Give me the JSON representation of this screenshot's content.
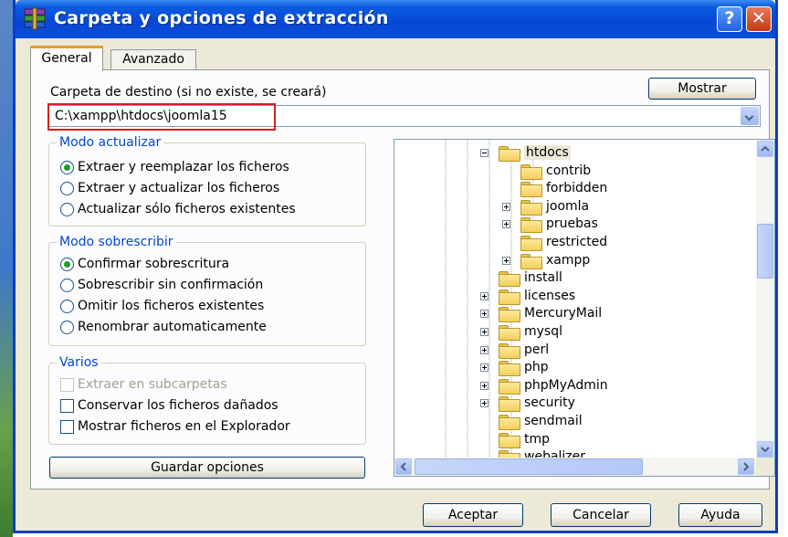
{
  "window": {
    "title": "Carpeta y opciones de extracción",
    "help_label": "?",
    "close_label": "✕"
  },
  "tabs": [
    {
      "label": "General",
      "active": true
    },
    {
      "label": "Avanzado",
      "active": false
    }
  ],
  "destination": {
    "label": "Carpeta de destino (si no existe, se creará)",
    "show_button": "Mostrar",
    "path": "C:\\xampp\\htdocs\\joomla15"
  },
  "update_mode": {
    "title": "Modo actualizar",
    "options": [
      {
        "label": "Extraer y reemplazar los ficheros",
        "selected": true
      },
      {
        "label": "Extraer y actualizar los ficheros",
        "selected": false
      },
      {
        "label": "Actualizar sólo ficheros existentes",
        "selected": false
      }
    ]
  },
  "overwrite_mode": {
    "title": "Modo sobrescribir",
    "options": [
      {
        "label": "Confirmar sobrescritura",
        "selected": true
      },
      {
        "label": "Sobrescribir sin confirmación",
        "selected": false
      },
      {
        "label": "Omitir los ficheros existentes",
        "selected": false
      },
      {
        "label": "Renombrar automaticamente",
        "selected": false
      }
    ]
  },
  "misc": {
    "title": "Varios",
    "options": [
      {
        "label": "Extraer en subcarpetas",
        "checked": false,
        "disabled": true
      },
      {
        "label": "Conservar los ficheros dañados",
        "checked": false,
        "disabled": false
      },
      {
        "label": "Mostrar ficheros en el Explorador",
        "checked": false,
        "disabled": false
      }
    ]
  },
  "save_button": "Guardar opciones",
  "tree": [
    {
      "label": "htdocs",
      "expander": "minus",
      "selected": true
    },
    {
      "label": "contrib",
      "expander": "none"
    },
    {
      "label": "forbidden",
      "expander": "none"
    },
    {
      "label": "joomla",
      "expander": "plus"
    },
    {
      "label": "pruebas",
      "expander": "plus"
    },
    {
      "label": "restricted",
      "expander": "none"
    },
    {
      "label": "xampp",
      "expander": "plus"
    },
    {
      "label": "install",
      "expander": "none"
    },
    {
      "label": "licenses",
      "expander": "plus"
    },
    {
      "label": "MercuryMail",
      "expander": "plus"
    },
    {
      "label": "mysql",
      "expander": "plus"
    },
    {
      "label": "perl",
      "expander": "plus"
    },
    {
      "label": "php",
      "expander": "plus"
    },
    {
      "label": "phpMyAdmin",
      "expander": "plus"
    },
    {
      "label": "security",
      "expander": "plus"
    },
    {
      "label": "sendmail",
      "expander": "none"
    },
    {
      "label": "tmp",
      "expander": "none"
    },
    {
      "label": "webalizer",
      "expander": "none"
    }
  ],
  "footer": {
    "ok": "Aceptar",
    "cancel": "Cancelar",
    "help": "Ayuda"
  },
  "colors": {
    "titlebar": "#0747d4",
    "group_title": "#0046d5",
    "highlight_box": "#d42020",
    "radio_dot": "#21a121"
  }
}
